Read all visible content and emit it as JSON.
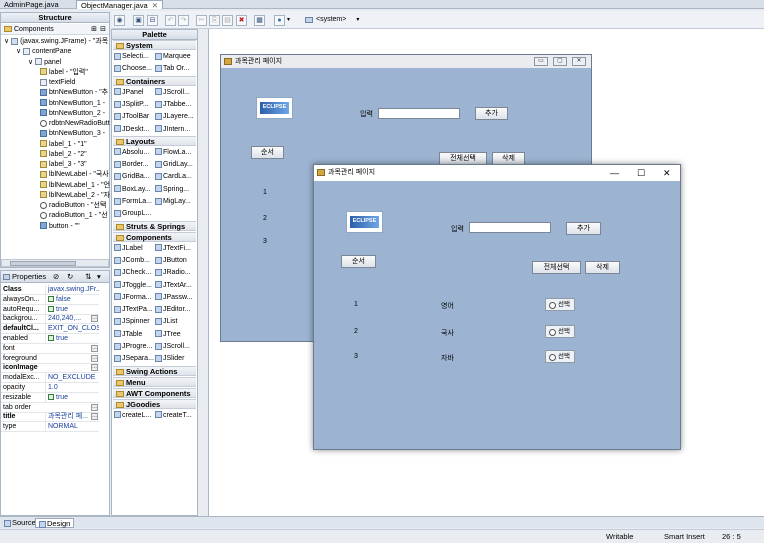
{
  "editor_tabs": [
    {
      "label": "AdminPage.java"
    },
    {
      "label": "ObjectManager.java",
      "active": true
    }
  ],
  "structure": {
    "title": "Structure",
    "components_title": "Components",
    "tree": [
      {
        "label": "(javax.swing.JFrame) - \"과목",
        "depth": 0,
        "icon": "frame"
      },
      {
        "label": "contentPane",
        "depth": 1,
        "icon": "panel"
      },
      {
        "label": "panel",
        "depth": 2,
        "icon": "panel"
      },
      {
        "label": "label - \"입력\"",
        "depth": 3,
        "icon": "lbl"
      },
      {
        "label": "textField",
        "depth": 3,
        "icon": "field"
      },
      {
        "label": "btnNewButton - \"추",
        "depth": 3,
        "icon": "btn"
      },
      {
        "label": "btnNewButton_1 -",
        "depth": 3,
        "icon": "btn"
      },
      {
        "label": "btnNewButton_2 -",
        "depth": 3,
        "icon": "btn"
      },
      {
        "label": "rdbtnNewRadioButt",
        "depth": 3,
        "icon": "radio"
      },
      {
        "label": "btnNewButton_3 -",
        "depth": 3,
        "icon": "btn"
      },
      {
        "label": "label_1 - \"1\"",
        "depth": 3,
        "icon": "lbl"
      },
      {
        "label": "label_2 - \"2\"",
        "depth": 3,
        "icon": "lbl"
      },
      {
        "label": "label_3 - \"3\"",
        "depth": 3,
        "icon": "lbl"
      },
      {
        "label": "lblNewLabel - \"국사",
        "depth": 3,
        "icon": "lbl"
      },
      {
        "label": "lblNewLabel_1 - \"언",
        "depth": 3,
        "icon": "lbl"
      },
      {
        "label": "lblNewLabel_2 - \"자",
        "depth": 3,
        "icon": "lbl"
      },
      {
        "label": "radioButton - \"선택",
        "depth": 3,
        "icon": "radio"
      },
      {
        "label": "radioButton_1 - \"선",
        "depth": 3,
        "icon": "radio"
      },
      {
        "label": "button - \"\"",
        "depth": 3,
        "icon": "btn"
      }
    ]
  },
  "properties": {
    "title": "Properties",
    "rows": [
      {
        "name": "Class",
        "value": "javax.swing.JFr...",
        "bold": true
      },
      {
        "name": "alwaysOn...",
        "value": "false",
        "check": true
      },
      {
        "name": "autoRequ...",
        "value": "true",
        "check": true
      },
      {
        "name": "backgrou...",
        "value": "240,240,...",
        "dots": true
      },
      {
        "name": "defaultCl...",
        "value": "EXIT_ON_CLOSE",
        "bold": true
      },
      {
        "name": "enabled",
        "value": "true",
        "check": true
      },
      {
        "name": "font",
        "value": "",
        "dots": true
      },
      {
        "name": "foreground",
        "value": "",
        "dots": true
      },
      {
        "name": "iconImage",
        "value": "",
        "bold": true,
        "dots": true
      },
      {
        "name": "modalExc...",
        "value": "NO_EXCLUDE"
      },
      {
        "name": "opacity",
        "value": "1.0"
      },
      {
        "name": "resizable",
        "value": "true",
        "check": true
      },
      {
        "name": "tab order",
        "value": "",
        "dots": true
      },
      {
        "name": "title",
        "value": "과목관리 페...",
        "bold": true,
        "dots": true
      },
      {
        "name": "type",
        "value": "NORMAL"
      }
    ]
  },
  "palette": {
    "title": "Palette",
    "system_label": "<system>",
    "categories": [
      {
        "name": "System",
        "items": [
          "Selecti...",
          "Marquee",
          "Choose...",
          "Tab Or..."
        ]
      },
      {
        "name": "Containers",
        "items": [
          "JPanel",
          "JScroll...",
          "JSplitP...",
          "JTabbe...",
          "JToolBar",
          "JLayere...",
          "JDeskt...",
          "JIntern..."
        ]
      },
      {
        "name": "Layouts",
        "items": [
          "Absolu...",
          "FlowLa...",
          "Border...",
          "GridLay...",
          "GridBa...",
          "CardLa...",
          "BoxLay...",
          "Spring...",
          "FormLa...",
          "MigLay...",
          "GroupL..."
        ]
      },
      {
        "name": "Struts & Springs",
        "items": []
      },
      {
        "name": "Components",
        "items": [
          "JLabel",
          "JTextFi...",
          "JComb...",
          "JButton",
          "JCheck...",
          "JRadio...",
          "JToggle...",
          "JTextAr...",
          "JForma...",
          "JPassw...",
          "JTextPa...",
          "JEditor...",
          "JSpinner",
          "JList",
          "JTable",
          "JTree",
          "JProgre...",
          "JScroll...",
          "JSepara...",
          "JSlider"
        ]
      },
      {
        "name": "Swing Actions",
        "items": []
      },
      {
        "name": "Menu",
        "items": []
      },
      {
        "name": "AWT Components",
        "items": []
      },
      {
        "name": "JGoodies",
        "items": [
          "createL...",
          "createT..."
        ]
      }
    ]
  },
  "design_window": {
    "title": "과목관리 페이지",
    "logo_text": "ECLIPSE",
    "input_label": "입력",
    "add_button": "추가",
    "order_button": "순서",
    "select_all_button": "전체선택",
    "delete_button": "삭제",
    "rows": [
      {
        "num": "1",
        "subject": "영어",
        "radio": "선택"
      },
      {
        "num": "2",
        "subject": "국사",
        "radio": "선택"
      },
      {
        "num": "3",
        "subject": "자바",
        "radio": "선택"
      }
    ]
  },
  "bottom_tabs": [
    {
      "label": "Source"
    },
    {
      "label": "Design",
      "active": true
    }
  ],
  "status": {
    "mode": "Writable",
    "insert": "Smart Insert",
    "position": "26 : 5"
  }
}
